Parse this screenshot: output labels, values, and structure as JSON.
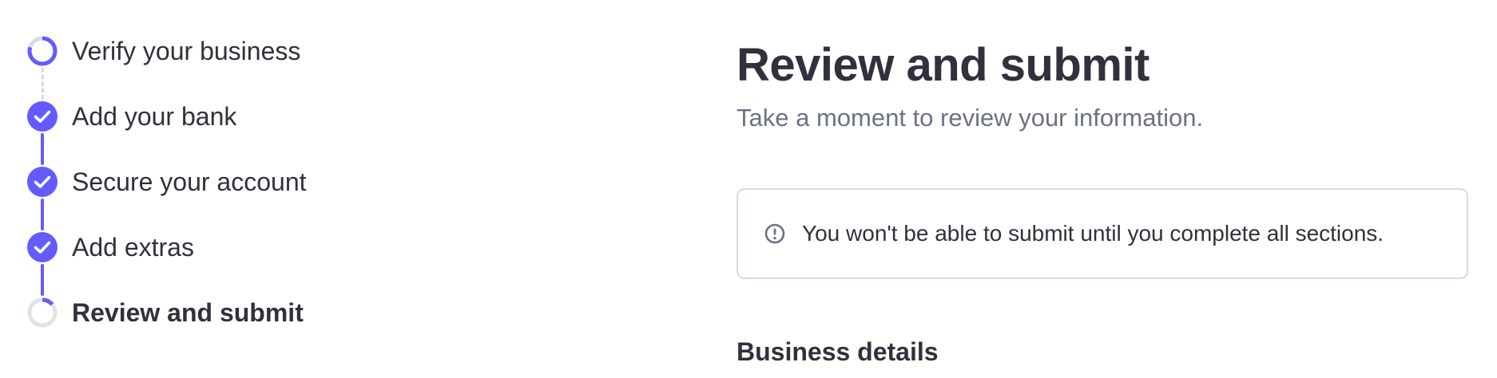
{
  "stepper": {
    "steps": [
      {
        "label": "Verify your business",
        "status": "in-progress"
      },
      {
        "label": "Add your bank",
        "status": "complete"
      },
      {
        "label": "Secure your account",
        "status": "complete"
      },
      {
        "label": "Add extras",
        "status": "complete"
      },
      {
        "label": "Review and submit",
        "status": "current"
      }
    ]
  },
  "main": {
    "title": "Review and submit",
    "subtitle": "Take a moment to review your information.",
    "notice": {
      "icon": "info-circle-icon",
      "text": "You won't be able to submit until you complete all sections."
    },
    "section_heading": "Business details"
  },
  "colors": {
    "accent": "#635bff",
    "text": "#30313d",
    "muted": "#6a7383",
    "border": "#d5dbe1"
  }
}
